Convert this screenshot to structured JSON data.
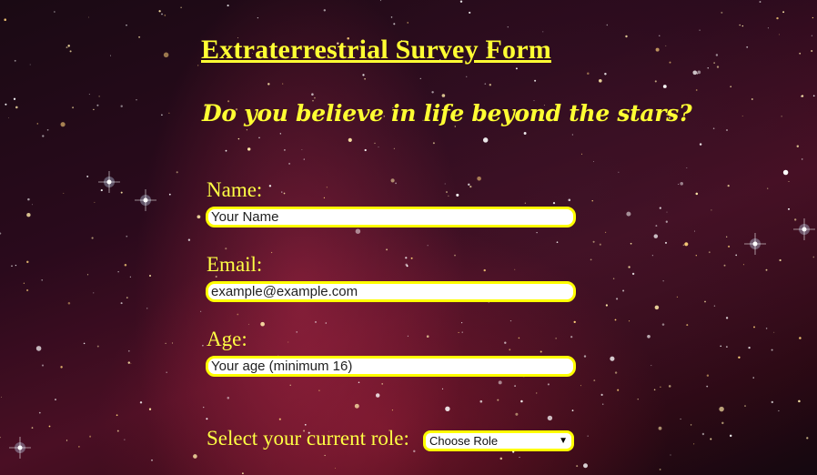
{
  "form": {
    "title": "Extraterrestrial Survey Form",
    "subtitle": "Do you believe in life beyond the stars?",
    "name": {
      "label": "Name:",
      "placeholder": "Your Name"
    },
    "email": {
      "label": "Email:",
      "placeholder": "example@example.com"
    },
    "age": {
      "label": "Age:",
      "placeholder": "Your age (minimum 16)"
    },
    "role": {
      "label": "Select your current role:",
      "selected": "Choose Role"
    }
  },
  "colors": {
    "text": "#ffff33",
    "field_border": "#ffff00",
    "field_bg": "#ffffff"
  },
  "icons": {
    "dropdown": "chevron-down-icon"
  }
}
